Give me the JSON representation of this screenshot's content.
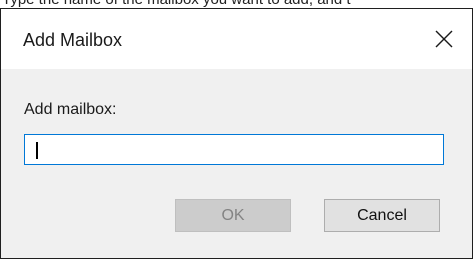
{
  "caption": {
    "text": "Type the name of the mailbox you want to add, and t"
  },
  "dialog": {
    "title": "Add Mailbox",
    "close_icon": "close-icon",
    "field_label": "Add mailbox:",
    "field_value": "",
    "ok_label": "OK",
    "ok_disabled": true,
    "cancel_label": "Cancel"
  },
  "colors": {
    "dialog_background": "#f0f0f0",
    "titlebar_background": "#ffffff",
    "input_focus_border": "#0078d7",
    "disabled_button_background": "#cccccc",
    "disabled_button_text": "#838383"
  }
}
